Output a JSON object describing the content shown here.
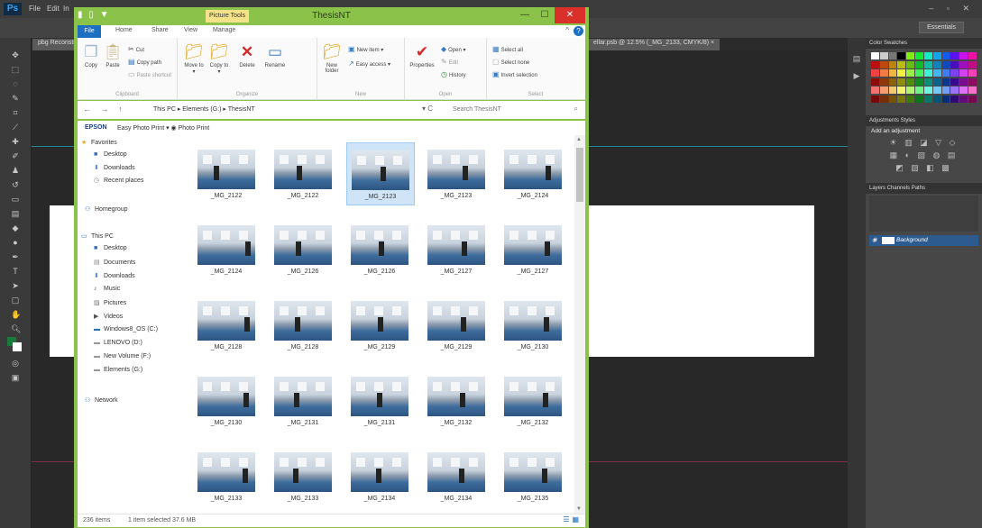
{
  "photoshop": {
    "logo": "Ps",
    "menu": [
      "File",
      "Edit",
      "In"
    ],
    "window_controls": "– ▫ ✕",
    "essentials": "Essentials",
    "doc_tab_left": "pbg Reconstr...",
    "doc_tab_right": "ellar.psb @ 12.5% (_MG_2133, CMYK/8) ×",
    "panels": {
      "swatches_tabs": "Color  Swatches",
      "adjustments_tabs": "Adjustments  Styles",
      "adjustments_heading": "Add an adjustment",
      "layers_tabs": "Layers  Channels  Paths",
      "layer_name": "Background"
    }
  },
  "explorer": {
    "title": "ThesisNT",
    "context_tab": "Picture Tools",
    "quick_access": "▮ ▯ ▼",
    "tabs": [
      "File",
      "Home",
      "Share",
      "View",
      "Manage"
    ],
    "ribbon": {
      "clipboard": {
        "label": "Clipboard",
        "copy": "Copy",
        "paste": "Paste",
        "cut": "Cut",
        "copy_path": "Copy path",
        "paste_shortcut": "Paste shortcut"
      },
      "organize": {
        "label": "Organize",
        "move_to": "Move to ▾",
        "copy_to": "Copy to ▾",
        "delete": "Delete",
        "rename": "Rename"
      },
      "new": {
        "label": "New",
        "new_folder": "New folder",
        "new_item": "New item ▾",
        "easy_access": "Easy access ▾"
      },
      "open": {
        "label": "Open",
        "properties": "Properties",
        "open": "Open ▾",
        "edit": "Edit",
        "history": "History"
      },
      "select": {
        "label": "Select",
        "select_all": "Select all",
        "select_none": "Select none",
        "invert_selection": "Invert selection"
      }
    },
    "address": {
      "nav": "← → ↑",
      "path": "This PC  ▸  Elements (G:)  ▸  ThesisNT",
      "refresh": "▾  C",
      "search_placeholder": "Search ThesisNT"
    },
    "epson": {
      "brand": "EPSON",
      "text": "Easy Photo Print  ▾  ◉ Photo Print"
    },
    "nav_pane": {
      "favorites": "Favorites",
      "favorites_items": [
        "Desktop",
        "Downloads",
        "Recent places"
      ],
      "homegroup": "Homegroup",
      "this_pc": "This PC",
      "this_pc_items": [
        "Desktop",
        "Documents",
        "Downloads",
        "Music",
        "Pictures",
        "Videos",
        "Windows8_OS (C:)",
        "LENOVO (D:)",
        "New Volume (F:)",
        "Elements (G:)"
      ],
      "network": "Network"
    },
    "thumbnails": [
      "_MG_2122",
      "_MG_2122",
      "_MG_2123",
      "_MG_2123",
      "_MG_2124",
      "_MG_2124",
      "_MG_2126",
      "_MG_2126",
      "_MG_2127",
      "_MG_2127",
      "_MG_2128",
      "_MG_2128",
      "_MG_2129",
      "_MG_2129",
      "_MG_2130",
      "_MG_2130",
      "_MG_2131",
      "_MG_2131",
      "_MG_2132",
      "_MG_2132",
      "_MG_2133",
      "_MG_2133",
      "_MG_2134",
      "_MG_2134",
      "_MG_2135"
    ],
    "selected_index": 2,
    "status": {
      "count": "236 items",
      "selection": "1 item selected  37.6 MB"
    }
  }
}
